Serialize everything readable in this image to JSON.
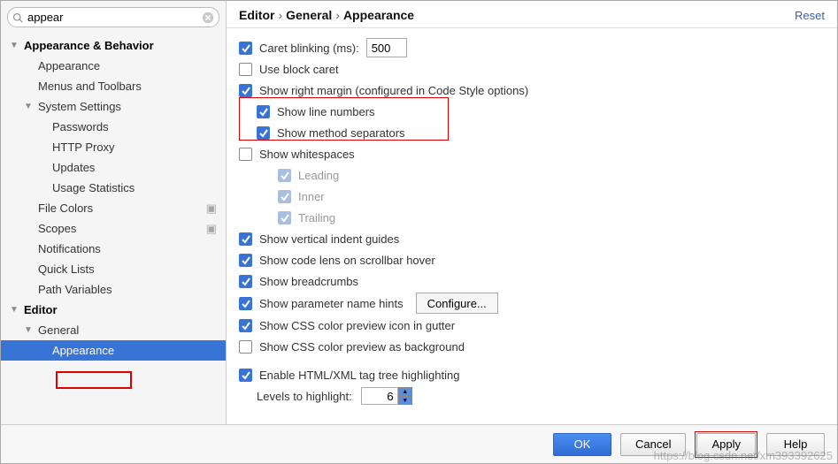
{
  "search": {
    "value": "appear"
  },
  "sidebar": {
    "appearance_behavior": "Appearance & Behavior",
    "appearance": "Appearance",
    "menus_toolbars": "Menus and Toolbars",
    "system_settings": "System Settings",
    "passwords": "Passwords",
    "http_proxy": "HTTP Proxy",
    "updates": "Updates",
    "usage_statistics": "Usage Statistics",
    "file_colors": "File Colors",
    "scopes": "Scopes",
    "notifications": "Notifications",
    "quick_lists": "Quick Lists",
    "path_variables": "Path Variables",
    "editor": "Editor",
    "general": "General",
    "appearance_sel": "Appearance"
  },
  "breadcrumb": {
    "p1": "Editor",
    "p2": "General",
    "p3": "Appearance"
  },
  "reset": "Reset",
  "opts": {
    "caret_blink_label": "Caret blinking (ms):",
    "caret_blink_value": "500",
    "use_block_caret": "Use block caret",
    "show_right_margin": "Show right margin (configured in Code Style options)",
    "show_line_numbers": "Show line numbers",
    "show_method_sep": "Show method separators",
    "show_whitespaces": "Show whitespaces",
    "leading": "Leading",
    "inner": "Inner",
    "trailing": "Trailing",
    "vert_indent": "Show vertical indent guides",
    "code_lens": "Show code lens on scrollbar hover",
    "breadcrumbs": "Show breadcrumbs",
    "param_hints": "Show parameter name hints",
    "configure": "Configure...",
    "css_gutter": "Show CSS color preview icon in gutter",
    "css_bg": "Show CSS color preview as background",
    "html_xml": "Enable HTML/XML tag tree highlighting",
    "levels_label": "Levels to highlight:",
    "levels_value": "6"
  },
  "buttons": {
    "ok": "OK",
    "cancel": "Cancel",
    "apply": "Apply",
    "help": "Help"
  },
  "watermark": "https://blog.csdn.net/xm393392625"
}
